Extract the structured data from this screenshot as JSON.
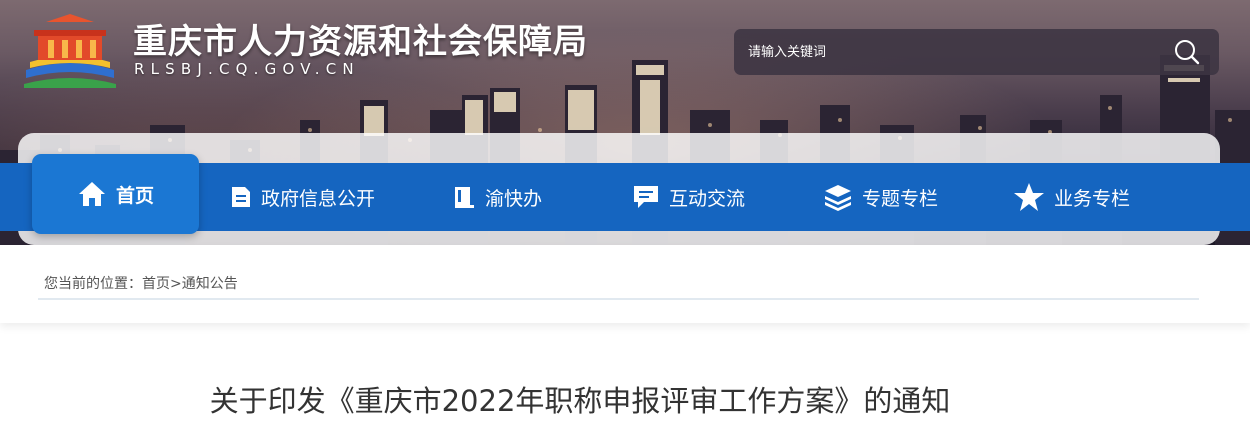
{
  "header": {
    "site_title": "重庆市人力资源和社会保障局",
    "site_domain": "RLSBJ.CQ.GOV.CN",
    "logo_icon": "chongqing-government-logo",
    "search": {
      "placeholder": "请输入关键词",
      "icon": "search-icon"
    }
  },
  "nav": {
    "items": [
      {
        "label": "首页",
        "icon": "home-icon",
        "active": true
      },
      {
        "label": "政府信息公开",
        "icon": "document-icon",
        "active": false
      },
      {
        "label": "渝快办",
        "icon": "book-icon",
        "active": false
      },
      {
        "label": "互动交流",
        "icon": "chat-icon",
        "active": false
      },
      {
        "label": "专题专栏",
        "icon": "layers-icon",
        "active": false
      },
      {
        "label": "业务专栏",
        "icon": "star-icon",
        "active": false
      }
    ]
  },
  "breadcrumb": {
    "prefix": "您当前的位置：",
    "items": [
      "首页",
      "通知公告"
    ],
    "separator": ">"
  },
  "article": {
    "title": "关于印发《重庆市2022年职称申报评审工作方案》的通知"
  },
  "colors": {
    "nav_bar": "#1565c0",
    "nav_active": "#1b77d3",
    "text_dark": "#333333",
    "text_muted": "#555555"
  }
}
